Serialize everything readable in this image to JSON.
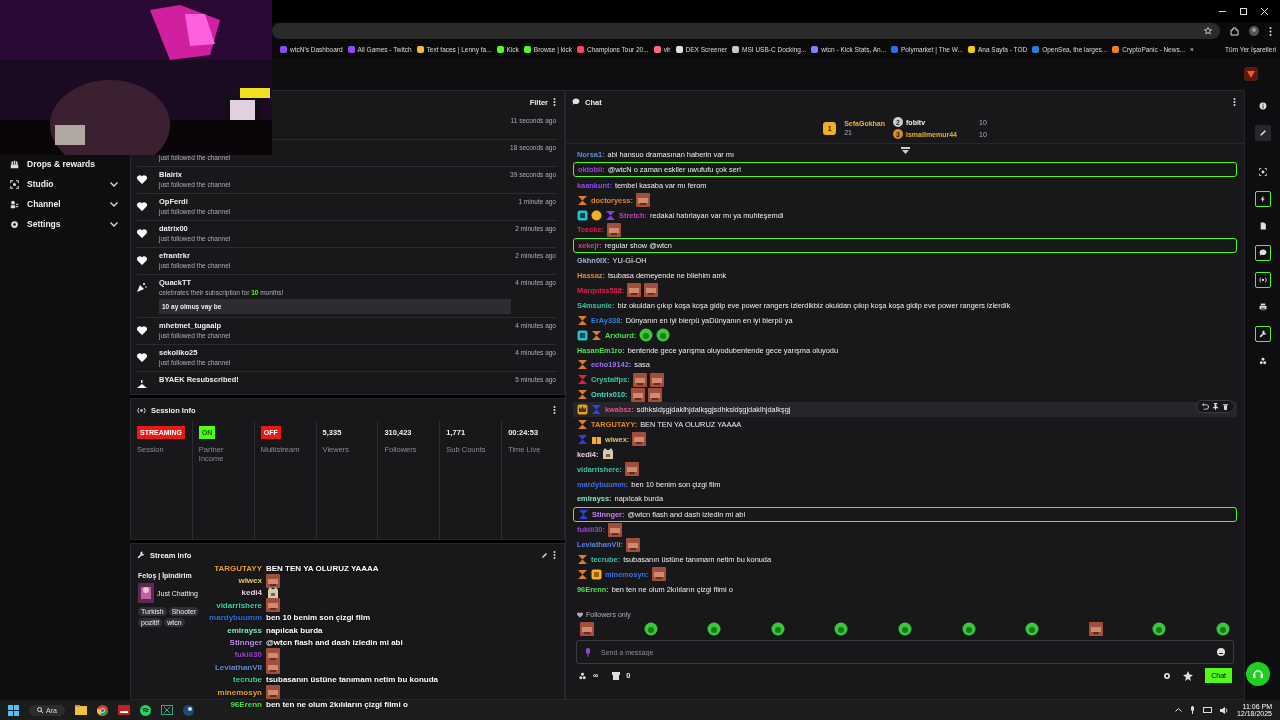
{
  "browser": {
    "bookmarks": [
      {
        "label": "wtcN's Dashboard",
        "color": "#9147ff"
      },
      {
        "label": "All Games - Twitch",
        "color": "#9147ff"
      },
      {
        "label": "Text faces | Lenny fa...",
        "color": "#f0c030"
      },
      {
        "label": "Kick",
        "color": "#53fc18"
      },
      {
        "label": "Browse | kick",
        "color": "#53fc18"
      },
      {
        "label": "Champions Tour 20...",
        "color": "#ff4655"
      },
      {
        "label": "vlr",
        "color": "#ff6b7a"
      },
      {
        "label": "DEX Screener",
        "color": "#e0e0e0"
      },
      {
        "label": "MSI USB-C Docking...",
        "color": "#c8c8c8"
      },
      {
        "label": "wtcn - Kick Stats, An...",
        "color": "#8080ff"
      },
      {
        "label": "Polymarket | The W...",
        "color": "#2d6cf0"
      },
      {
        "label": "Ana Sayfa - TOD",
        "color": "#f0d000"
      },
      {
        "label": "OpenSea, the larges...",
        "color": "#2081e2"
      },
      {
        "label": "CryptoPanic - News...",
        "color": "#f08020"
      }
    ],
    "more": "»",
    "all_bookmarks": "Tüm Yer İşaretleri"
  },
  "sidebar": {
    "items": [
      {
        "label": "Drops & rewards",
        "kind": "gift",
        "expandable": false
      },
      {
        "label": "Studio",
        "kind": "studio",
        "expandable": true
      },
      {
        "label": "Channel",
        "kind": "channel",
        "expandable": true
      },
      {
        "label": "Settings",
        "kind": "settings",
        "expandable": true
      }
    ]
  },
  "activity": {
    "filter": "Filter",
    "items": [
      {
        "kind": "follow",
        "time": "11 seconds ago"
      },
      {
        "kind": "follow",
        "detail": "just followed the channel",
        "time": "18 seconds ago"
      },
      {
        "kind": "follow",
        "name": "Blairix",
        "detail": "just followed the channel",
        "time": "39 seconds ago"
      },
      {
        "kind": "follow",
        "name": "OpFerdi",
        "detail": "just followed the channel",
        "time": "1 minute ago"
      },
      {
        "kind": "follow",
        "name": "datrix00",
        "detail": "just followed the channel",
        "time": "2 minutes ago"
      },
      {
        "kind": "follow",
        "name": "efrantrkr",
        "detail": "just followed the channel",
        "time": "2 minutes ago"
      },
      {
        "kind": "sub",
        "name": "QuackTT",
        "detail": "celebrates their subscription for **10** months!",
        "message": "10 ay olmuş vay be",
        "time": "4 minutes ago"
      },
      {
        "kind": "follow",
        "name": "mhetmet_tugaalp",
        "detail": "just followed the channel",
        "time": "4 minutes ago"
      },
      {
        "kind": "follow",
        "name": "sekoliko25",
        "detail": "just followed the channel",
        "time": "4 minutes ago"
      },
      {
        "kind": "resub",
        "name": "BYAEK Resubscribed!",
        "time": "5 minutes ago"
      }
    ]
  },
  "session_info": {
    "title": "Session Info",
    "stats": [
      {
        "kind": "status",
        "value": "STREAMING",
        "color": "#e91916",
        "label": "Session"
      },
      {
        "kind": "status",
        "value": "ON",
        "color": "#53fc18",
        "label": "Partner Income"
      },
      {
        "kind": "status",
        "value": "OFF",
        "color": "#e91916",
        "label": "Multistream"
      },
      {
        "kind": "number",
        "value": "5,335",
        "label": "Viewers"
      },
      {
        "kind": "number",
        "value": "310,423",
        "label": "Followers"
      },
      {
        "kind": "number",
        "value": "1,771",
        "label": "Sub Counts"
      },
      {
        "kind": "number",
        "value": "00:24:53",
        "label": "Time Live"
      }
    ]
  },
  "stream_info": {
    "title": "Stream Info",
    "stream_title": "Feloş | İpindirim",
    "category": "Just Chatting",
    "tags": [
      "Turkish",
      "Shooter",
      "pozitif",
      "wtcn"
    ]
  },
  "overlay_chat": [
    {
      "name": "TARGUTAYY",
      "color": "#e8a030",
      "text": "BEN TEN YA OLURUZ YAAAA"
    },
    {
      "name": "wiwex",
      "color": "#e8d070",
      "emotes": [
        {
          "kind": "face"
        }
      ]
    },
    {
      "name": "kedi4",
      "color": "#f0d0e0",
      "emotes": [
        {
          "kind": "cat"
        }
      ]
    },
    {
      "name": "vidarrishere",
      "color": "#40d0a0",
      "emotes": [
        {
          "kind": "face"
        }
      ]
    },
    {
      "name": "mardybuumm",
      "color": "#3070e0",
      "text": "ben 10 benim son çizgi film"
    },
    {
      "name": "emirayss",
      "color": "#80e8c8",
      "text": "napılcak burda"
    },
    {
      "name": "Stinnger",
      "color": "#c090f0",
      "text": "@wtcn flash and dash izledin mi abi"
    },
    {
      "name": "fukiii30",
      "color": "#a040e0",
      "emotes": [
        {
          "kind": "face"
        }
      ]
    },
    {
      "name": "LeviathanVII",
      "color": "#6090e0",
      "emotes": [
        {
          "kind": "face"
        }
      ]
    },
    {
      "name": "tecrube",
      "color": "#40d0a0",
      "text": "tsubasanın üstüne tanımam netim bu konuda"
    },
    {
      "name": "minemosyn",
      "color": "#e8a030",
      "emotes": [
        {
          "kind": "face"
        }
      ]
    },
    {
      "name": "96Erenn",
      "color": "#50e050",
      "text": "ben ten ne olum 2kılıların çizgi filmi o"
    }
  ],
  "chat": {
    "title": "Chat",
    "leaderboard": {
      "first": {
        "rank": "1",
        "name": "SefaGokhan",
        "count": "21"
      },
      "others": [
        {
          "rank": "2",
          "name": "fobitv",
          "count": "10"
        },
        {
          "rank": "3",
          "name": "ismailmemur44",
          "count": "10"
        }
      ]
    },
    "messages": [
      {
        "name": "Norsa1:",
        "color": "#5a8fd8",
        "text": "abi hansuo dramasınan haberin var mı",
        "highlighted": false,
        "hovered": false
      },
      {
        "name": "oktobii:",
        "color": "#a040e0",
        "text": "@wtcN o zaman eskiler uwufufu çok seri",
        "highlighted": true,
        "hovered": false
      },
      {
        "name": "kaankunt:",
        "color": "#9147ff",
        "text": "tembel kasaba var mı ferom",
        "highlighted": false,
        "hovered": false
      },
      {
        "name": "doctoryess:",
        "color": "#e08a20",
        "badges": [
          {
            "kind": "hourglass"
          }
        ],
        "emotes": [
          {
            "kind": "face"
          }
        ],
        "highlighted": false,
        "hovered": false
      },
      {
        "name": "Stretch:",
        "color": "#c040c0",
        "badges": [
          {
            "kind": "cube"
          },
          {
            "kind": "coin"
          },
          {
            "kind": "hourglass-purple"
          }
        ],
        "text": "redakai hatırlayan var mı ya muhteşemdi",
        "highlighted": false,
        "hovered": false
      },
      {
        "name": "Teecke:",
        "color": "#e0204c",
        "emotes": [
          {
            "kind": "face"
          }
        ],
        "highlighted": false,
        "hovered": false
      },
      {
        "name": "xekejr:",
        "color": "#d04080",
        "text": "regular show @wtcn",
        "highlighted": true,
        "hovered": false
      },
      {
        "name": "Gkhn0IX:",
        "color": "#a0b4d8",
        "text": "YU-Gİ-OH",
        "highlighted": false,
        "hovered": false
      },
      {
        "name": "Hassaz:",
        "color": "#e08a20",
        "text": "tsubasa demeyende ne bilehim amk",
        "highlighted": false,
        "hovered": false
      },
      {
        "name": "Marquiss588:",
        "color": "#e0204c",
        "emotes": [
          {
            "kind": "face"
          },
          {
            "kind": "face"
          }
        ],
        "highlighted": false,
        "hovered": false
      },
      {
        "name": "S4msunle:",
        "color": "#40c0a0",
        "text": "biz okuldan çıkıp koşa koşa gidip eve power rangers izlerdikbiz okuldan çıkıp koşa koşa gidip eve power rangers izlerdik",
        "highlighted": false,
        "hovered": false
      },
      {
        "name": "ErAy338:",
        "color": "#3080e0",
        "badges": [
          {
            "kind": "hourglass"
          }
        ],
        "text": "Dünyanın en iyi bierpü yaDünyanın en iyi bierpü ya",
        "highlighted": false,
        "hovered": false
      },
      {
        "name": "Arxhurd:",
        "color": "#50e050",
        "badges": [
          {
            "kind": "cube"
          },
          {
            "kind": "hourglass"
          }
        ],
        "emotes": [
          {
            "kind": "frog"
          },
          {
            "kind": "frog"
          }
        ],
        "highlighted": false,
        "hovered": false
      },
      {
        "name": "HasanEm1ro:",
        "color": "#50e050",
        "text": "bentende gece yarışma oluyodubentende gece yarışma oluyodu",
        "highlighted": false,
        "hovered": false
      },
      {
        "name": "echo19142:",
        "color": "#a070ff",
        "badges": [
          {
            "kind": "hourglass"
          }
        ],
        "text": "sasa",
        "highlighted": false,
        "hovered": false
      },
      {
        "name": "Crystalfps:",
        "color": "#40c0a0",
        "badges": [
          {
            "kind": "hourglass-red"
          }
        ],
        "emotes": [
          {
            "kind": "face"
          },
          {
            "kind": "face"
          }
        ],
        "highlighted": false,
        "hovered": false
      },
      {
        "name": "Ontrix010:",
        "color": "#40e0c0",
        "badges": [
          {
            "kind": "hourglass"
          }
        ],
        "emotes": [
          {
            "kind": "face"
          },
          {
            "kind": "face"
          }
        ],
        "highlighted": false,
        "hovered": false
      },
      {
        "name": "kwabsz:",
        "color": "#e05090",
        "badges": [
          {
            "kind": "crown"
          },
          {
            "kind": "hourglass-blue"
          }
        ],
        "text": "sdhksldşgjdaklhjdalkşgjsdhksldşgjdaklhjdalkşgj",
        "highlighted": false,
        "hovered": true
      },
      {
        "name": "TARGUTAYY:",
        "color": "#e08a20",
        "badges": [
          {
            "kind": "hourglass"
          }
        ],
        "text": "BEN TEN YA OLURUZ YAAAA",
        "highlighted": false,
        "hovered": false
      },
      {
        "name": "wiwex:",
        "color": "#e0c060",
        "badges": [
          {
            "kind": "hourglass-blue"
          },
          {
            "kind": "gift"
          }
        ],
        "emotes": [
          {
            "kind": "face"
          }
        ],
        "highlighted": false,
        "hovered": false
      },
      {
        "name": "kedi4:",
        "color": "#e8d0dc",
        "emotes": [
          {
            "kind": "cat"
          }
        ],
        "highlighted": false,
        "hovered": false
      },
      {
        "name": "vidarrishere:",
        "color": "#40c0a0",
        "emotes": [
          {
            "kind": "face"
          }
        ],
        "highlighted": false,
        "hovered": false
      },
      {
        "name": "mardybuumm:",
        "color": "#3f70e0",
        "text": "ben 10 benim son çizgi film",
        "highlighted": false,
        "hovered": false
      },
      {
        "name": "emirayss:",
        "color": "#80e0c0",
        "text": "napılcak burda",
        "highlighted": false,
        "hovered": false
      },
      {
        "name": "Stinnger:",
        "color": "#c080f0",
        "badges": [
          {
            "kind": "hourglass-blue"
          }
        ],
        "text": "@wtcn flash and dash izledin mi abi",
        "highlighted": true,
        "hovered": false
      },
      {
        "name": "fukiii30:",
        "color": "#a040e0",
        "emotes": [
          {
            "kind": "face"
          }
        ],
        "highlighted": false,
        "hovered": false
      },
      {
        "name": "LeviathanVII:",
        "color": "#6080e0",
        "emotes": [
          {
            "kind": "face"
          }
        ],
        "highlighted": false,
        "hovered": false
      },
      {
        "name": "tecrube:",
        "color": "#40c0a0",
        "badges": [
          {
            "kind": "hourglass"
          }
        ],
        "text": "tsubasanın üstüne tanımam netim bu konuda",
        "highlighted": false,
        "hovered": false
      },
      {
        "name": "minemosyn:",
        "color": "#3f70e0",
        "badges": [
          {
            "kind": "hourglass"
          },
          {
            "kind": "tier"
          }
        ],
        "emotes": [
          {
            "kind": "face"
          }
        ],
        "highlighted": false,
        "hovered": false
      },
      {
        "name": "96Erenn:",
        "color": "#50e050",
        "text": "ben ten ne olum 2kılıların çizgi filmi o",
        "highlighted": false,
        "hovered": false
      }
    ],
    "followers_only": "Followers only",
    "input": {
      "placeholder": "Send a message"
    },
    "points": "∞",
    "kicks": "0",
    "send": "Chat"
  },
  "rail": [
    {
      "kind": "info",
      "highlighted": false
    },
    {
      "kind": "pencil",
      "highlighted": false
    },
    {
      "kind": "scan",
      "highlighted": false
    },
    {
      "kind": "bolt",
      "highlighted": true
    },
    {
      "kind": "doc",
      "highlighted": false
    },
    {
      "kind": "chat",
      "highlighted": true
    },
    {
      "kind": "broadcast",
      "highlighted": true
    },
    {
      "kind": "printer",
      "highlighted": false
    },
    {
      "kind": "wrench",
      "highlighted": true
    },
    {
      "kind": "nodes",
      "highlighted": false
    }
  ],
  "taskbar": {
    "search": "Ara",
    "time": "11:06 PM",
    "date": "12/18/2025"
  }
}
